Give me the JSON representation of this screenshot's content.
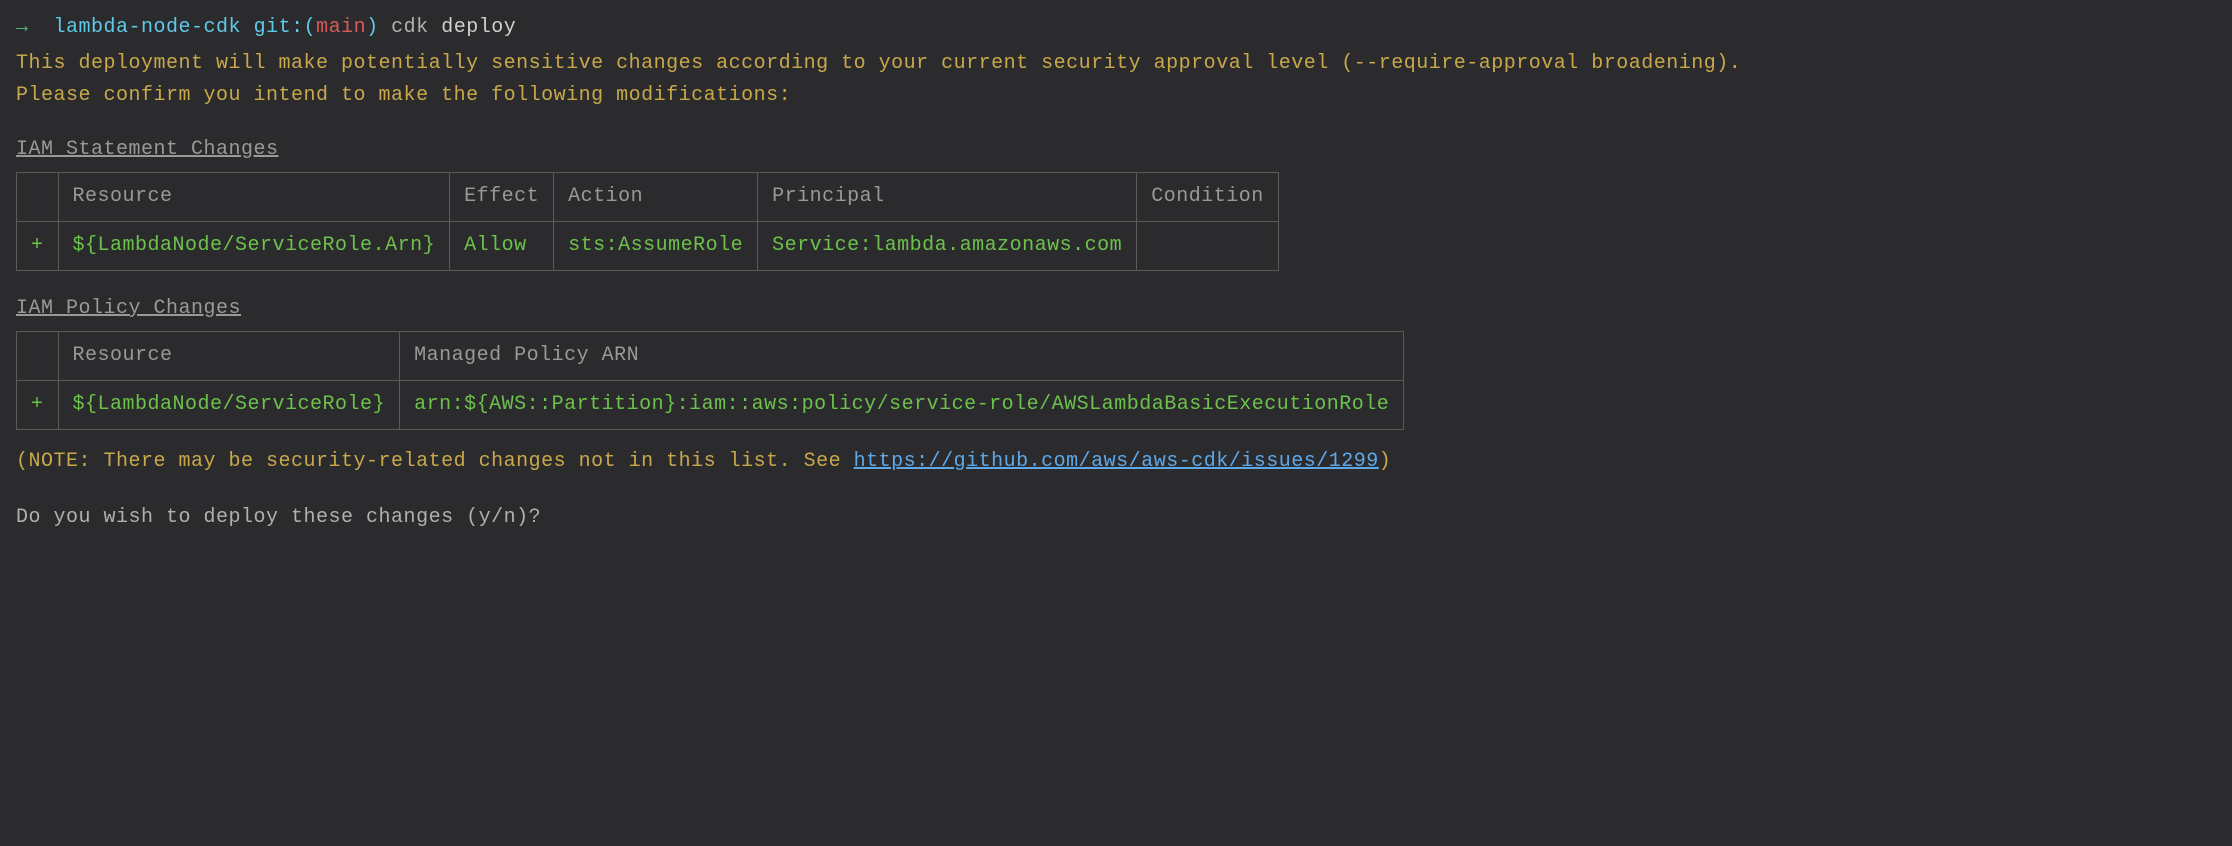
{
  "prompt": {
    "arrow": "→",
    "directory": "lambda-node-cdk",
    "git_label": "git:",
    "branch": "main",
    "command": "cdk",
    "arg": "deploy"
  },
  "warning": {
    "line1": "This deployment will make potentially sensitive changes according to your current security approval level (--require-approval broadening).",
    "line2": "Please confirm you intend to make the following modifications:"
  },
  "iam_statement": {
    "header": "IAM Statement Changes",
    "columns": {
      "sign": "",
      "resource": "Resource",
      "effect": "Effect",
      "action": "Action",
      "principal": "Principal",
      "condition": "Condition"
    },
    "row": {
      "sign": "+",
      "resource": "${LambdaNode/ServiceRole.Arn}",
      "effect": "Allow",
      "action": "sts:AssumeRole",
      "principal": "Service:lambda.amazonaws.com",
      "condition": ""
    }
  },
  "iam_policy": {
    "header": "IAM Policy Changes",
    "columns": {
      "sign": "",
      "resource": "Resource",
      "managed_policy": "Managed Policy ARN"
    },
    "row": {
      "sign": "+",
      "resource": "${LambdaNode/ServiceRole}",
      "managed_policy": "arn:${AWS::Partition}:iam::aws:policy/service-role/AWSLambdaBasicExecutionRole"
    }
  },
  "note": {
    "prefix": "(NOTE: There may be security-related changes not in this list. See ",
    "link": "https://github.com/aws/aws-cdk/issues/1299",
    "suffix": ")"
  },
  "question": "Do you wish to deploy these changes (y/n)?"
}
